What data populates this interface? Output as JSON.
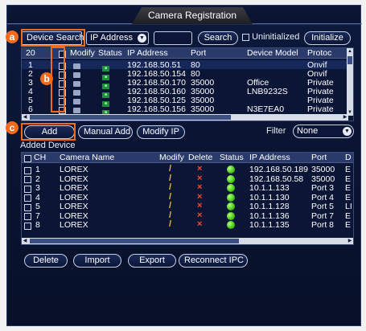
{
  "title": "Camera Registration",
  "search_bar": {
    "device_search": "Device Search",
    "protocol_value": "IP Address",
    "search": "Search",
    "uninitialized": "Uninitialized",
    "initialize": "Initialize"
  },
  "device_table": {
    "count": "20",
    "headers": [
      "Modify",
      "Status",
      "IP Address",
      "Port",
      "Device Model",
      "Protoc"
    ],
    "rows": [
      {
        "num": "1",
        "ip": "192.168.50.51",
        "port": "80",
        "model": "",
        "protocol": "Onvif"
      },
      {
        "num": "2",
        "ip": "192.168.50.154",
        "port": "80",
        "model": "",
        "protocol": "Onvif"
      },
      {
        "num": "3",
        "ip": "192.168.50.170",
        "port": "35000",
        "model": "Office",
        "protocol": "Private"
      },
      {
        "num": "4",
        "ip": "192.168.50.160",
        "port": "35000",
        "model": "LNB9232S",
        "protocol": "Private"
      },
      {
        "num": "5",
        "ip": "192.168.50.125",
        "port": "35000",
        "model": "",
        "protocol": "Private"
      },
      {
        "num": "6",
        "ip": "192.168.50.156",
        "port": "35000",
        "model": "N3E7EA0",
        "protocol": "Private"
      }
    ]
  },
  "actions": {
    "add": "Add",
    "manual_add": "Manual Add",
    "modify_ip": "Modify IP",
    "filter_label": "Filter",
    "filter_value": "None"
  },
  "added": {
    "section_label": "Added Device",
    "headers": [
      "CH",
      "Camera Name",
      "Modify",
      "Delete",
      "Status",
      "IP Address",
      "Port",
      "D"
    ],
    "rows": [
      {
        "ch": "1",
        "name": "LOREX",
        "ip": "192.168.50.189",
        "port": "35000",
        "d": "E"
      },
      {
        "ch": "2",
        "name": "LOREX",
        "ip": "192.168.50.58",
        "port": "35000",
        "d": "E"
      },
      {
        "ch": "3",
        "name": "LOREX",
        "ip": "10.1.1.133",
        "port": "Port 3",
        "d": "E"
      },
      {
        "ch": "4",
        "name": "LOREX",
        "ip": "10.1.1.130",
        "port": "Port 4",
        "d": "E"
      },
      {
        "ch": "5",
        "name": "LOREX",
        "ip": "10.1.1.128",
        "port": "Port 5",
        "d": "LI"
      },
      {
        "ch": "7",
        "name": "LOREX",
        "ip": "10.1.1.136",
        "port": "Port 7",
        "d": "E"
      },
      {
        "ch": "8",
        "name": "LOREX",
        "ip": "10.1.1.135",
        "port": "Port 8",
        "d": "E"
      }
    ]
  },
  "bottom": {
    "delete": "Delete",
    "import": "Import",
    "export": "Export",
    "reconnect": "Reconnect IPC"
  },
  "callouts": {
    "a": "a",
    "b": "b",
    "c": "c"
  },
  "colors": {
    "accent": "#f26a1b",
    "background": "#0a1533",
    "status_green": "#44c414"
  }
}
